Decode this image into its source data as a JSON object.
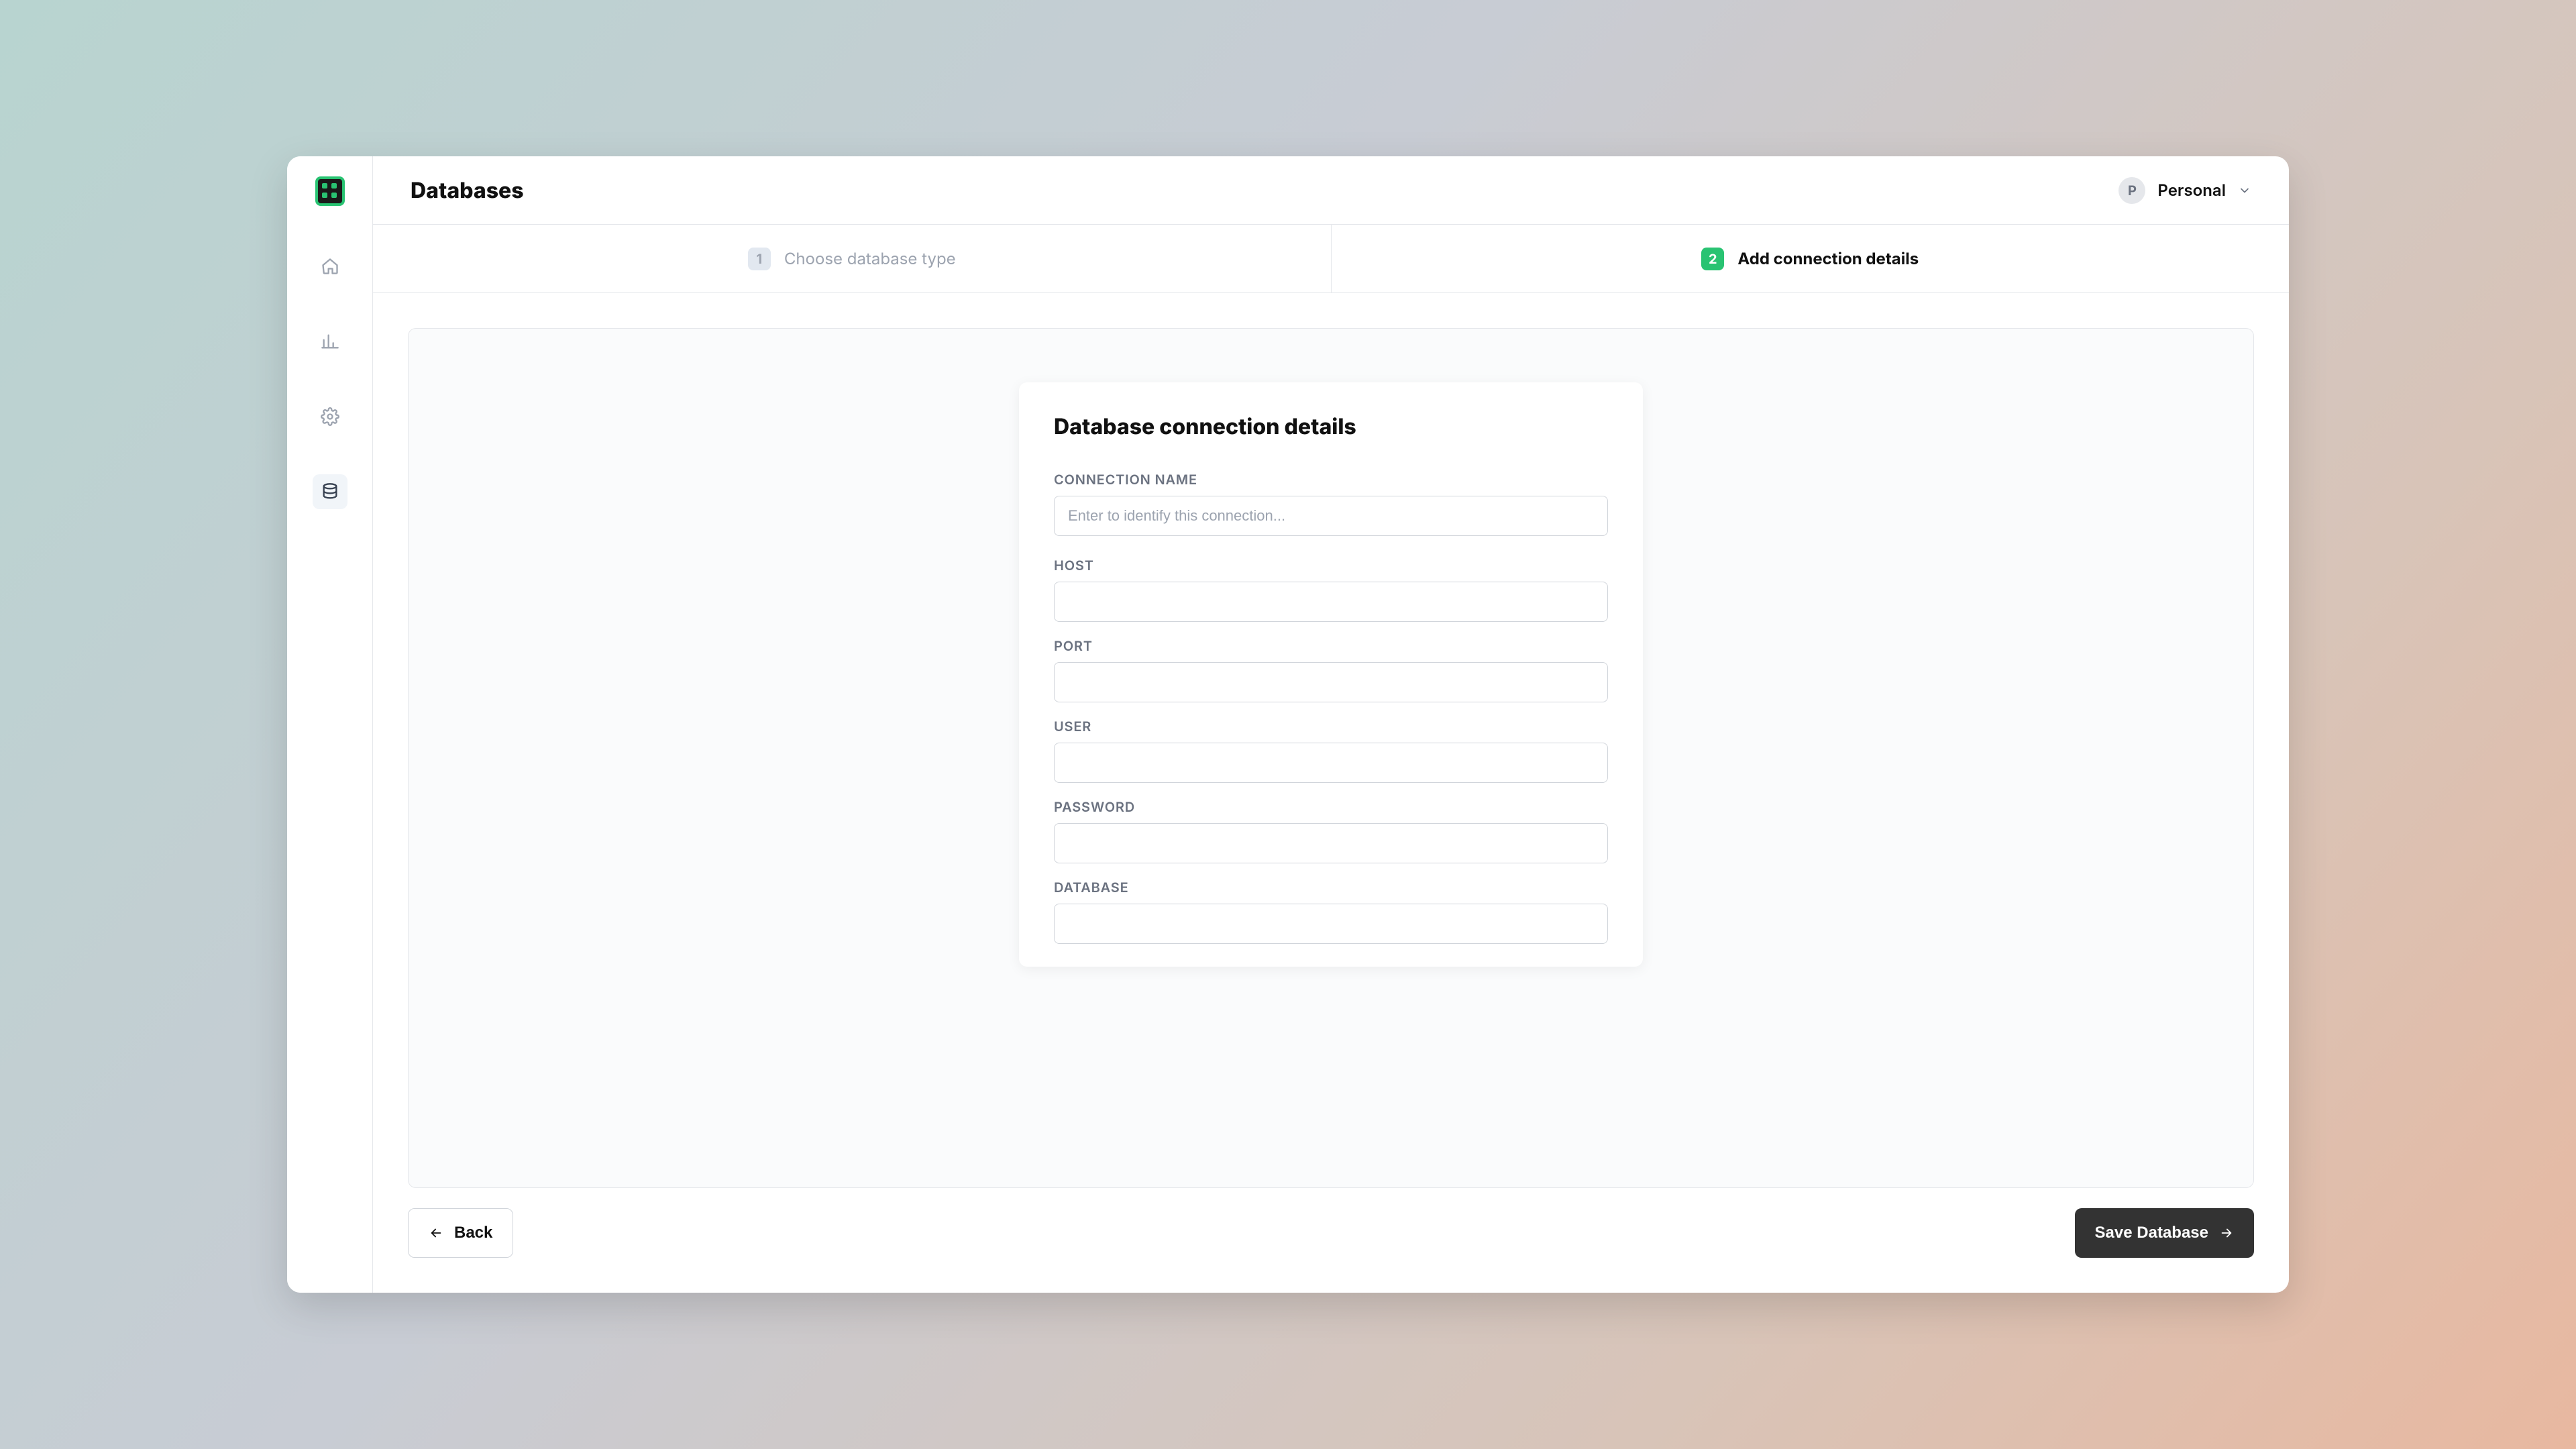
{
  "header": {
    "title": "Databases",
    "avatar_initial": "P",
    "workspace_name": "Personal"
  },
  "steps": {
    "step1": {
      "number": "1",
      "label": "Choose database type"
    },
    "step2": {
      "number": "2",
      "label": "Add connection details"
    }
  },
  "form": {
    "title": "Database connection details",
    "connection_name": {
      "label": "CONNECTION NAME",
      "placeholder": "Enter to identify this connection..."
    },
    "host": {
      "label": "HOST"
    },
    "port": {
      "label": "PORT"
    },
    "user": {
      "label": "USER"
    },
    "password": {
      "label": "PASSWORD"
    },
    "database": {
      "label": "DATABASE"
    }
  },
  "actions": {
    "back": "Back",
    "save": "Save Database"
  }
}
